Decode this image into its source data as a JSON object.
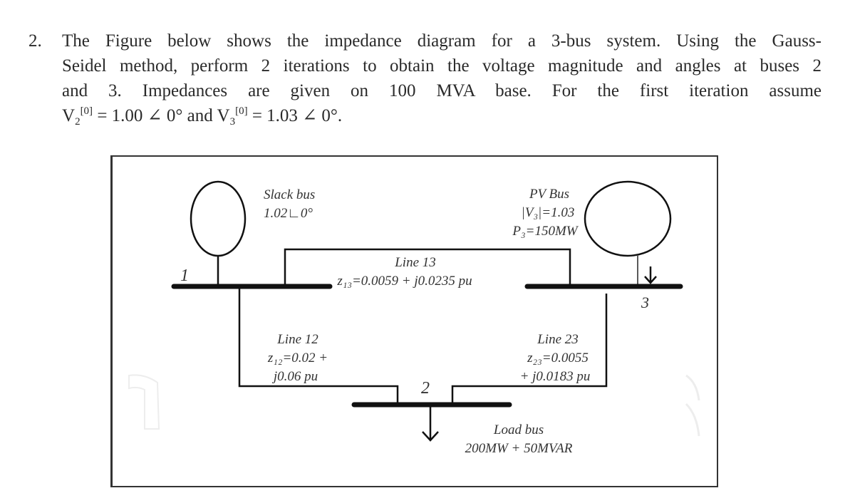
{
  "question": {
    "number": "2.",
    "lines": [
      "The Figure below shows the impedance diagram for a 3-bus system. Using the Gauss-",
      "Seidel method, perform 2 iterations to obtain the voltage magnitude and angles at buses 2",
      "and 3. Impedances are given on 100 MVA base. For the first iteration assume"
    ],
    "initial_conditions": {
      "v2_symbol": "V",
      "v2_sub": "2",
      "v2_sup": "[0]",
      "v2_value": " = 1.00 ∠ 0° and ",
      "v3_symbol": "V",
      "v3_sub": "3",
      "v3_sup": "[0]",
      "v3_value": " =  1.03 ∠ 0°."
    }
  },
  "diagram": {
    "slack_bus": {
      "title": "Slack bus",
      "value": "1.02∟0°",
      "bus_number": "1"
    },
    "pv_bus": {
      "title": "PV Bus",
      "voltage": "|V₃|=1.03",
      "power": "P₃=150MW",
      "bus_number": "3"
    },
    "load_bus": {
      "title": "Load bus",
      "value": "200MW + 50MVAR",
      "bus_number": "2"
    },
    "line_13": {
      "title": "Line 13",
      "impedance": "z₁₃=0.0059 + j0.0235 pu"
    },
    "line_12": {
      "title": "Line 12",
      "impedance_line1": "z₁₂=0.02 +",
      "impedance_line2": "j0.06 pu"
    },
    "line_23": {
      "title": "Line 23",
      "impedance_line1": "z₂₃=0.0055",
      "impedance_line2": "+ j0.0183 pu"
    }
  }
}
